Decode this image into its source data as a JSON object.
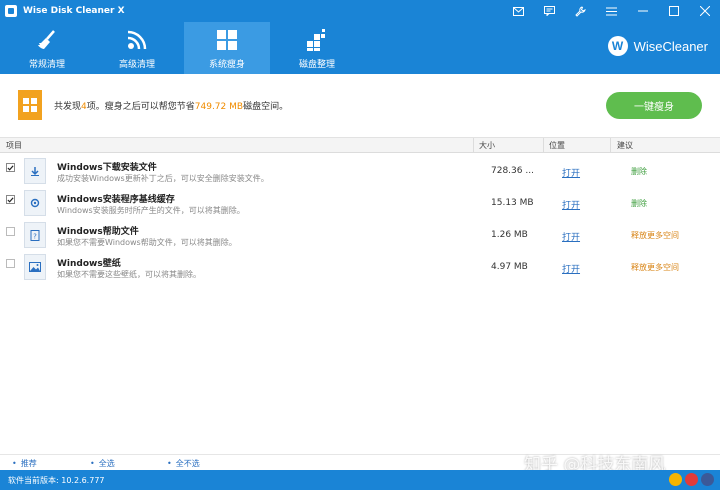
{
  "window": {
    "title": "Wise Disk Cleaner X"
  },
  "nav": {
    "tabs": [
      {
        "label": "常规清理",
        "icon": "broom-icon"
      },
      {
        "label": "高级清理",
        "icon": "advanced-clean-icon"
      },
      {
        "label": "系统瘦身",
        "icon": "windows-icon",
        "active": true
      },
      {
        "label": "磁盘整理",
        "icon": "defrag-icon"
      }
    ],
    "brand": "WiseCleaner",
    "brand_logo_letter": "W"
  },
  "summary": {
    "prefix": "共发现",
    "count": "4",
    "mid": "项。瘦身之后可以帮您节省",
    "size": "749.72 MB",
    "suffix": "磁盘空间。",
    "button": "一键瘦身"
  },
  "table": {
    "headers": {
      "item": "项目",
      "size": "大小",
      "location": "位置",
      "suggestion": "建议"
    },
    "rows": [
      {
        "checked": true,
        "title": "Windows下载安装文件",
        "desc": "成功安装Windows更新补丁之后，可以安全删除安装文件。",
        "size": "728.36 ...",
        "open": "打开",
        "suggestion": "删除",
        "tone": "green",
        "icon": "download-icon"
      },
      {
        "checked": true,
        "title": "Windows安装程序基线缓存",
        "desc": "Windows安装服务时所产生的文件，可以将其删除。",
        "size": "15.13 MB",
        "open": "打开",
        "suggestion": "删除",
        "tone": "green",
        "icon": "installer-icon"
      },
      {
        "checked": false,
        "title": "Windows帮助文件",
        "desc": "如果您不需要Windows帮助文件，可以将其删除。",
        "size": "1.26 MB",
        "open": "打开",
        "suggestion": "释放更多空间",
        "tone": "orange",
        "icon": "help-file-icon"
      },
      {
        "checked": false,
        "title": "Windows壁纸",
        "desc": "如果您不需要这些壁纸，可以将其删除。",
        "size": "4.97 MB",
        "open": "打开",
        "suggestion": "释放更多空间",
        "tone": "orange",
        "icon": "wallpaper-icon"
      }
    ]
  },
  "bottom": {
    "recommend": "推荐",
    "select_all": "全选",
    "select_none": "全不选"
  },
  "status": {
    "version": "软件当前版本: 10.2.6.777"
  },
  "watermark": "知乎 @科技东南风",
  "colors": {
    "accent": "#1a84d6",
    "primary_button": "#5fbd4e",
    "highlight": "#f08c00",
    "suggest_delete": "#3e9e3e",
    "suggest_free": "#d88415"
  }
}
